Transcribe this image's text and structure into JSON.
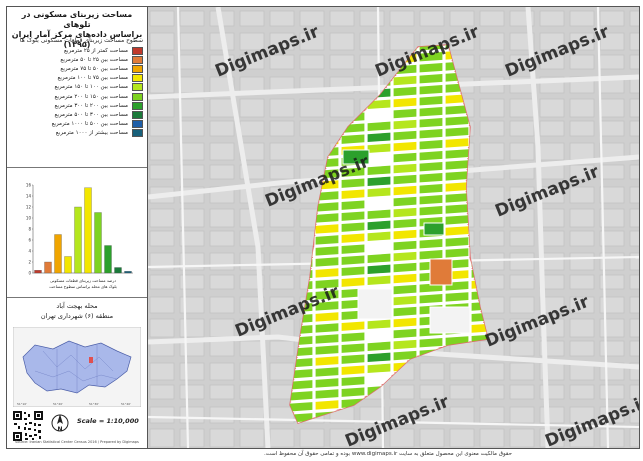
{
  "title": {
    "line1": "مساحت زیربنای مسکونی در تلوهای",
    "line2": "براساس داده‌های مرکز آمار ایران (۱۳۹۵)"
  },
  "legend": {
    "title": "سطوح مساحت زیربنای قطعات مسکونی بلوک ها",
    "items": [
      {
        "label": "مساحت کمتر از ۲۵ مترمربع",
        "color": "#c0392b"
      },
      {
        "label": "مساحت بین ۲۵ تا ۵۰ مترمربع",
        "color": "#e07b39"
      },
      {
        "label": "مساحت بین ۵۰ تا ۷۵ مترمربع",
        "color": "#f0a500"
      },
      {
        "label": "مساحت بین ۷۵ تا ۱۰۰ مترمربع",
        "color": "#f2e600"
      },
      {
        "label": "مساحت بین ۱۰۰ تا ۱۵۰ مترمربع",
        "color": "#b5e61d"
      },
      {
        "label": "مساحت بین ۱۵۰ تا ۲۰۰ مترمربع",
        "color": "#7ed321"
      },
      {
        "label": "مساحت بین ۲۰۰ تا ۳۰۰ مترمربع",
        "color": "#2ca02c"
      },
      {
        "label": "مساحت بین ۳۰۰ تا ۵۰۰ مترمربع",
        "color": "#1b7a3a"
      },
      {
        "label": "مساحت بین ۵۰۰ تا ۱۰۰۰ مترمربع",
        "color": "#1f5fa8"
      },
      {
        "label": "مساحت بیشتر از ۱۰۰۰ مترمربع",
        "color": "#17607a"
      }
    ]
  },
  "chart_data": {
    "type": "bar",
    "categories": [
      "1",
      "2",
      "3",
      "4",
      "5",
      "6",
      "7",
      "8",
      "9",
      "10"
    ],
    "values": [
      0.5,
      2,
      7,
      3,
      12,
      15.5,
      11,
      5,
      1,
      0.3
    ],
    "colors": [
      "#c0392b",
      "#e07b39",
      "#f0a500",
      "#f2e600",
      "#b5e61d",
      "#f2e600",
      "#7ed321",
      "#2ca02c",
      "#1b7a3a",
      "#17607a"
    ],
    "yticks": [
      "0",
      "2",
      "4",
      "6",
      "8",
      "10",
      "12",
      "14",
      "16"
    ],
    "ylim": [
      0,
      16
    ],
    "caption_line1": "درصد مساحت زیربنای قطعات مسکونی",
    "caption_line2": "بلوک های محله براساس سطوح مساحت"
  },
  "region": {
    "neighborhood": "محله بهجت آباد",
    "district": "منطقه (۶) شهرداری تهران"
  },
  "scale_text": "Scale = 1:10,000",
  "credit_text": "Source: Iranian Statistical Center Census 2016 / Prepared by Digimaps",
  "watermark": "Digimaps.ir",
  "footer": "حقوق مالکیت معنوی این محصول متعلق به سایت www.digimaps.ir بوده و تمامی حقوق آن محفوظ است."
}
